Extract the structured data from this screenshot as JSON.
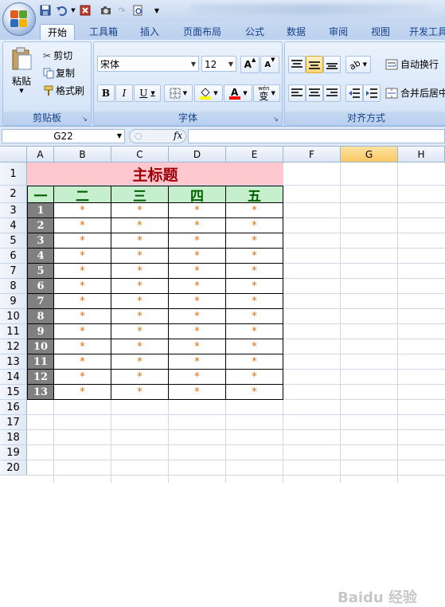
{
  "tabs": [
    "开始",
    "工具箱",
    "插入",
    "页面布局",
    "公式",
    "数据",
    "审阅",
    "视图",
    "开发工具"
  ],
  "clipboard": {
    "paste": "粘贴",
    "cut": "剪切",
    "copy": "复制",
    "format_painter": "格式刷",
    "label": "剪贴板"
  },
  "font": {
    "name": "宋体",
    "size": "12",
    "label": "字体",
    "bold": "B",
    "italic": "I",
    "underline": "U",
    "grow": "A",
    "phonetic": "wén"
  },
  "alignment": {
    "wrap": "自动换行",
    "merge": "合并后居中",
    "label": "对齐方式"
  },
  "formula_bar": {
    "cell_ref": "G22",
    "fx": "fx",
    "formula": ""
  },
  "columns": [
    "A",
    "B",
    "C",
    "D",
    "E",
    "F",
    "G",
    "H"
  ],
  "selected_column": "G",
  "rows": [
    "1",
    "2",
    "3",
    "4",
    "5",
    "6",
    "7",
    "8",
    "9",
    "10",
    "11",
    "12",
    "13",
    "14",
    "15",
    "16",
    "17",
    "18",
    "19",
    "20"
  ],
  "sheet": {
    "title": "主标题",
    "headers": [
      "一",
      "二",
      "三",
      "四",
      "五"
    ],
    "numbers": [
      "1",
      "2",
      "3",
      "4",
      "5",
      "6",
      "7",
      "8",
      "9",
      "10",
      "11",
      "12",
      "13"
    ],
    "star": "*"
  },
  "colors": {
    "title_fill": "#ffc7ce",
    "title_text": "#9c0006",
    "header_fill": "#c6efce",
    "header_text": "#006100",
    "number_fill": "#808080",
    "star": "#e36c09"
  },
  "watermark": "Baidu 经验"
}
